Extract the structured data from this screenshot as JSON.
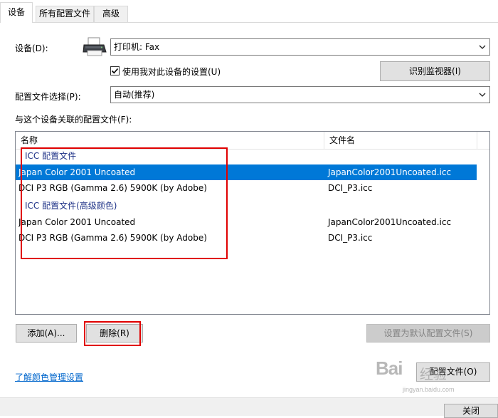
{
  "tabs": [
    {
      "label": "设备",
      "active": true
    },
    {
      "label": "所有配置文件",
      "active": false
    },
    {
      "label": "高级",
      "active": false
    }
  ],
  "device": {
    "label": "设备(D):",
    "value": "打印机: Fax",
    "icon": "printer-icon"
  },
  "use_my_settings": {
    "label": "使用我对此设备的设置(U)",
    "checked": true
  },
  "identify_button": "识别监视器(I)",
  "profile_selection": {
    "label": "配置文件选择(P):",
    "value": "自动(推荐)"
  },
  "associated_label": "与这个设备关联的配置文件(F):",
  "listview": {
    "columns": [
      "名称",
      "文件名"
    ],
    "groups": [
      {
        "title": "ICC 配置文件",
        "rows": [
          {
            "name": "Japan Color 2001 Uncoated",
            "file": "JapanColor2001Uncoated.icc",
            "selected": true
          },
          {
            "name": "DCI P3 RGB (Gamma 2.6) 5900K (by Adobe)",
            "file": "DCI_P3.icc",
            "selected": false
          }
        ]
      },
      {
        "title": "ICC 配置文件(高级颜色)",
        "rows": [
          {
            "name": "Japan Color 2001 Uncoated",
            "file": "JapanColor2001Uncoated.icc",
            "selected": false
          },
          {
            "name": "DCI P3 RGB (Gamma 2.6) 5900K (by Adobe)",
            "file": "DCI_P3.icc",
            "selected": false
          }
        ]
      }
    ]
  },
  "buttons": {
    "add": "添加(A)...",
    "remove": "删除(R)",
    "set_default": "设置为默认配置文件(S)",
    "profiles": "配置文件(O)",
    "close": "关闭"
  },
  "learn_link": "了解颜色管理设置",
  "watermark": {
    "brand": "Bai",
    "brand_cn": "经验",
    "url": "jingyan.baidu.com"
  },
  "colors": {
    "selection": "#0078d7",
    "annotation": "#e00000",
    "group_title": "#1e3287",
    "link": "#0066cc"
  }
}
